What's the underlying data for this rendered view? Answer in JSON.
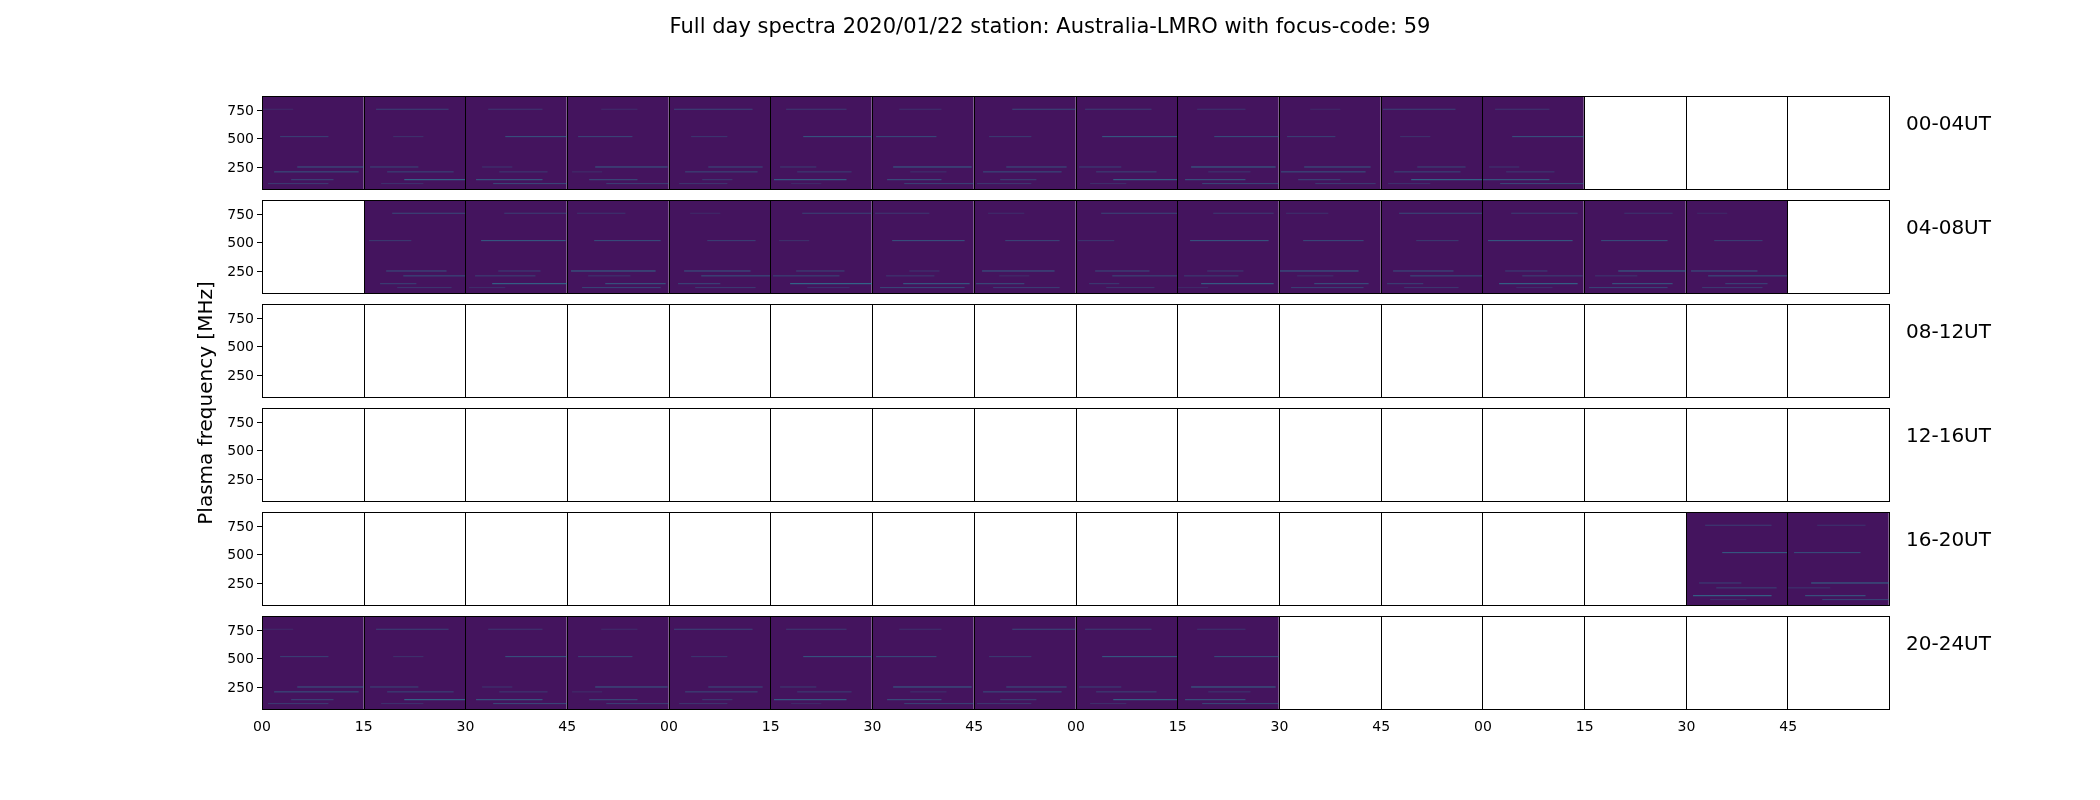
{
  "title": "Full day spectra 2020/01/22 station: Australia-LMRO with focus-code: 59",
  "ylabel": "Plasma frequency [MHz]",
  "rows": [
    {
      "label": "00-04UT",
      "y_tick_labels": [
        "750",
        "500",
        "250"
      ],
      "panels_with_data": [
        true,
        true,
        true,
        true,
        true,
        true,
        true,
        true,
        true,
        true,
        true,
        true,
        true,
        false,
        false,
        false
      ]
    },
    {
      "label": "04-08UT",
      "y_tick_labels": [
        "750",
        "500",
        "250"
      ],
      "panels_with_data": [
        false,
        true,
        true,
        true,
        true,
        true,
        true,
        true,
        true,
        true,
        true,
        true,
        true,
        true,
        true,
        false
      ]
    },
    {
      "label": "08-12UT",
      "y_tick_labels": [
        "750",
        "500",
        "250"
      ],
      "panels_with_data": [
        false,
        false,
        false,
        false,
        false,
        false,
        false,
        false,
        false,
        false,
        false,
        false,
        false,
        false,
        false,
        false
      ]
    },
    {
      "label": "12-16UT",
      "y_tick_labels": [
        "750",
        "500",
        "250"
      ],
      "panels_with_data": [
        false,
        false,
        false,
        false,
        false,
        false,
        false,
        false,
        false,
        false,
        false,
        false,
        false,
        false,
        false,
        false
      ]
    },
    {
      "label": "16-20UT",
      "y_tick_labels": [
        "750",
        "500",
        "250"
      ],
      "panels_with_data": [
        false,
        false,
        false,
        false,
        false,
        false,
        false,
        false,
        false,
        false,
        false,
        false,
        false,
        false,
        true,
        true
      ]
    },
    {
      "label": "20-24UT",
      "y_tick_labels": [
        "750",
        "500",
        "250"
      ],
      "panels_with_data": [
        true,
        true,
        true,
        true,
        true,
        true,
        true,
        true,
        true,
        true,
        false,
        false,
        false,
        false,
        false,
        false
      ]
    }
  ],
  "x_tick_labels": [
    "00",
    "15",
    "30",
    "45",
    "00",
    "15",
    "30",
    "45",
    "00",
    "15",
    "30",
    "45",
    "00",
    "15",
    "30",
    "45"
  ]
}
